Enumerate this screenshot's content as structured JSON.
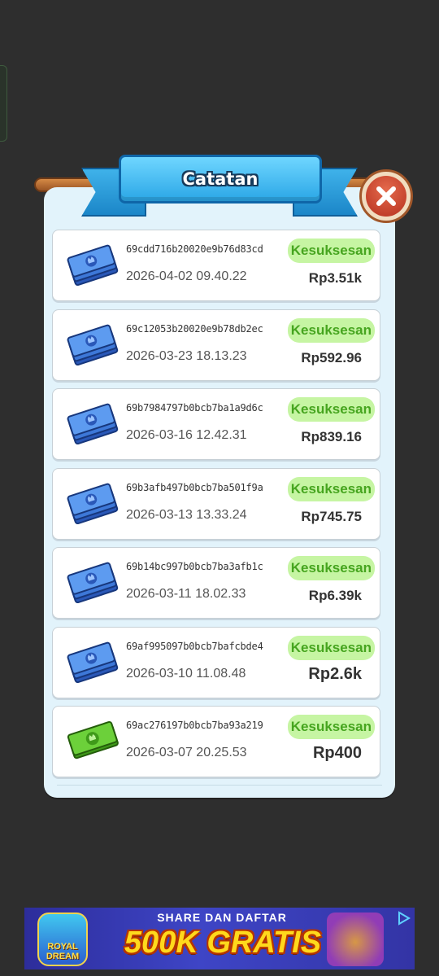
{
  "dialog": {
    "title": "Catatan"
  },
  "records": [
    {
      "id": "69cdd716b20020e9b76d83cd",
      "date": "2026-04-02 09.40.22",
      "status": "Kesuksesan",
      "amount": "Rp3.51k",
      "icon": "blue-cash-stack-icon"
    },
    {
      "id": "69c12053b20020e9b78db2ec",
      "date": "2026-03-23 18.13.23",
      "status": "Kesuksesan",
      "amount": "Rp592.96",
      "icon": "blue-cash-stack-icon"
    },
    {
      "id": "69b7984797b0bcb7ba1a9d6c",
      "date": "2026-03-16 12.42.31",
      "status": "Kesuksesan",
      "amount": "Rp839.16",
      "icon": "blue-cash-stack-icon"
    },
    {
      "id": "69b3afb497b0bcb7ba501f9a",
      "date": "2026-03-13 13.33.24",
      "status": "Kesuksesan",
      "amount": "Rp745.75",
      "icon": "blue-cash-stack-icon"
    },
    {
      "id": "69b14bc997b0bcb7ba3afb1c",
      "date": "2026-03-11 18.02.33",
      "status": "Kesuksesan",
      "amount": "Rp6.39k",
      "icon": "blue-cash-stack-icon"
    },
    {
      "id": "69af995097b0bcb7bafcbde4",
      "date": "2026-03-10 11.08.48",
      "status": "Kesuksesan",
      "amount": "Rp2.6k",
      "icon": "blue-cash-stack-icon"
    },
    {
      "id": "69ac276197b0bcb7ba93a219",
      "date": "2026-03-07 20.25.53",
      "status": "Kesuksesan",
      "amount": "Rp400",
      "icon": "green-cash-icon"
    }
  ],
  "ad": {
    "line1": "SHARE DAN DAFTAR",
    "line2": "500K GRATIS",
    "logo_text": "ROYAL DREAM"
  },
  "colors": {
    "status_text": "#46a51f",
    "status_bg": "#c6f5a3",
    "title_blue": "#2aa6e6",
    "close_red": "#b6301f"
  }
}
